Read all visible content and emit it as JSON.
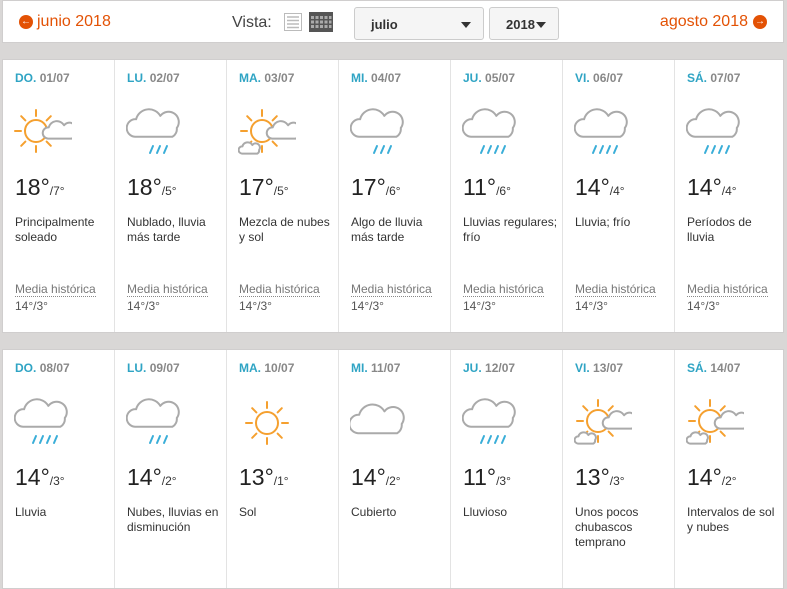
{
  "header": {
    "prev_month": "junio 2018",
    "next_month": "agosto 2018",
    "vista_label": "Vista:",
    "month_select": "julio",
    "year_select": "2018"
  },
  "colors": {
    "accent": "#e35205",
    "weekday": "#2fa4c4",
    "sun": "#f5a02f",
    "cloud": "#aaaaaa",
    "rain": "#3aaed8"
  },
  "weeks": [
    {
      "days": [
        {
          "weekday": "DO.",
          "date": "01/07",
          "icon": "sun-cloud-icon",
          "hi": "18°",
          "lo": "/7°",
          "desc": "Principalmente soleado",
          "hist_label": "Media histórica",
          "hist_val": "14°/3°"
        },
        {
          "weekday": "LU.",
          "date": "02/07",
          "icon": "cloud-rain-icon",
          "hi": "18°",
          "lo": "/5°",
          "desc": "Nublado, lluvia más tarde",
          "hist_label": "Media histórica",
          "hist_val": "14°/3°"
        },
        {
          "weekday": "MA.",
          "date": "03/07",
          "icon": "sun-clouds-icon",
          "hi": "17°",
          "lo": "/5°",
          "desc": "Mezcla de nubes y sol",
          "hist_label": "Media histórica",
          "hist_val": "14°/3°"
        },
        {
          "weekday": "MI.",
          "date": "04/07",
          "icon": "cloud-rain-icon",
          "hi": "17°",
          "lo": "/6°",
          "desc": "Algo de lluvia más tarde",
          "hist_label": "Media histórica",
          "hist_val": "14°/3°"
        },
        {
          "weekday": "JU.",
          "date": "05/07",
          "icon": "cloud-heavy-rain-icon",
          "hi": "11°",
          "lo": "/6°",
          "desc": "Lluvias regulares; frío",
          "hist_label": "Media histórica",
          "hist_val": "14°/3°"
        },
        {
          "weekday": "VI.",
          "date": "06/07",
          "icon": "cloud-heavy-rain-icon",
          "hi": "14°",
          "lo": "/4°",
          "desc": "Lluvia; frío",
          "hist_label": "Media histórica",
          "hist_val": "14°/3°"
        },
        {
          "weekday": "SÁ.",
          "date": "07/07",
          "icon": "cloud-heavy-rain-icon",
          "hi": "14°",
          "lo": "/4°",
          "desc": "Períodos de lluvia",
          "hist_label": "Media histórica",
          "hist_val": "14°/3°"
        }
      ]
    },
    {
      "days": [
        {
          "weekday": "DO.",
          "date": "08/07",
          "icon": "cloud-heavy-rain-icon",
          "hi": "14°",
          "lo": "/3°",
          "desc": "Lluvia"
        },
        {
          "weekday": "LU.",
          "date": "09/07",
          "icon": "cloud-rain-icon",
          "hi": "14°",
          "lo": "/2°",
          "desc": "Nubes, lluvias en disminución"
        },
        {
          "weekday": "MA.",
          "date": "10/07",
          "icon": "sun-icon",
          "hi": "13°",
          "lo": "/1°",
          "desc": "Sol"
        },
        {
          "weekday": "MI.",
          "date": "11/07",
          "icon": "cloud-icon",
          "hi": "14°",
          "lo": "/2°",
          "desc": "Cubierto"
        },
        {
          "weekday": "JU.",
          "date": "12/07",
          "icon": "cloud-heavy-rain-icon",
          "hi": "11°",
          "lo": "/3°",
          "desc": "Lluvioso"
        },
        {
          "weekday": "VI.",
          "date": "13/07",
          "icon": "sun-clouds-icon",
          "hi": "13°",
          "lo": "/3°",
          "desc": "Unos pocos chubascos temprano"
        },
        {
          "weekday": "SÁ.",
          "date": "14/07",
          "icon": "sun-clouds-icon",
          "hi": "14°",
          "lo": "/2°",
          "desc": "Intervalos de sol y nubes"
        }
      ]
    }
  ]
}
